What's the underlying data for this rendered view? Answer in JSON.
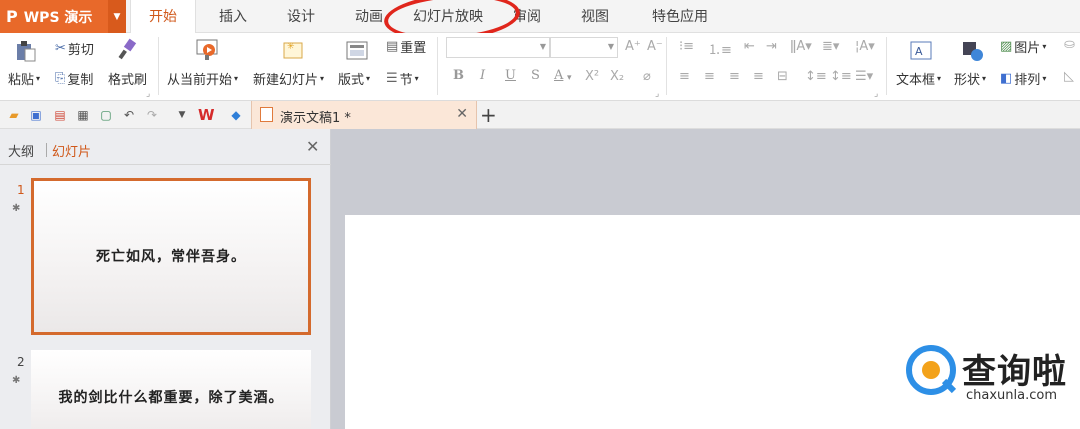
{
  "app": {
    "name": "WPS 演示",
    "logo": "P"
  },
  "menu": {
    "tabs": [
      "开始",
      "插入",
      "设计",
      "动画",
      "幻灯片放映",
      "审阅",
      "视图",
      "特色应用"
    ],
    "active_index": 0
  },
  "ribbon": {
    "paste": "粘贴",
    "cut": "剪切",
    "copy": "复制",
    "format_painter": "格式刷",
    "from_current": "从当前开始",
    "new_slide": "新建幻灯片",
    "layout": "版式",
    "reset": "重置",
    "section": "节",
    "bold": "B",
    "italic": "I",
    "underline": "U",
    "strike": "S",
    "font_color": "A",
    "superscript": "X²",
    "subscript": "X₂",
    "grow_font": "A⁺",
    "shrink_font": "A⁻",
    "textbox": "文本框",
    "shape": "形状",
    "picture": "图片",
    "arrange": "排列"
  },
  "document_tab": {
    "title": "演示文稿1 *"
  },
  "panel": {
    "outline_tab": "大纲",
    "slides_tab": "幻灯片",
    "slides": [
      {
        "number": "1",
        "text": "死亡如风，常伴吾身。"
      },
      {
        "number": "2",
        "text": "我的剑比什么都重要，除了美酒。"
      }
    ]
  },
  "watermark": {
    "title": "查询啦",
    "url": "chaxunla.com"
  },
  "colors": {
    "accent": "#e8692a",
    "active_tab_text": "#d0581a",
    "highlight_circle": "#e0261c",
    "selected_slide_border": "#d46a2d",
    "canvas_bg": "#c9cbd2"
  }
}
